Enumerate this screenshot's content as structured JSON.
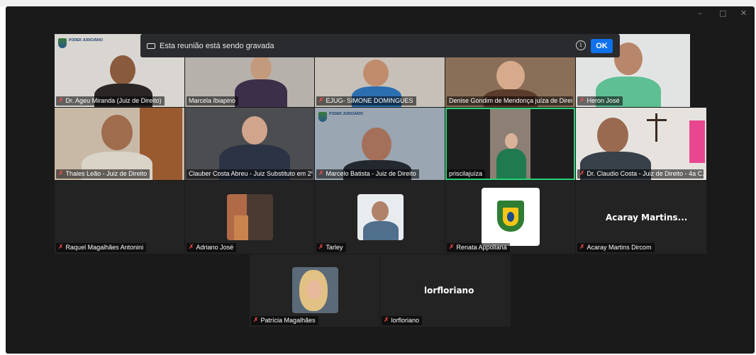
{
  "window": {
    "minimize_glyph": "–",
    "maximize_glyph": "□",
    "close_glyph": "✕"
  },
  "recording_banner": {
    "text": "Esta reunião está sendo gravada",
    "ok_label": "OK",
    "info_glyph": "i"
  },
  "logo": {
    "org": "PODER JUDICIÁRIO",
    "sub": "Tribunal de Justiça do Estado de Goiás"
  },
  "participants": [
    {
      "name": "Dr. Ageu Miranda (Juiz de Direito)",
      "muted": true
    },
    {
      "name": "Marcela Ibiapino",
      "muted": false
    },
    {
      "name": "EJUG- SIMONE DOMINGUES",
      "muted": true
    },
    {
      "name": "Denise Gondim de Mendonça juíza de Direi...",
      "muted": false
    },
    {
      "name": "Heron José",
      "muted": true
    },
    {
      "name": "Thales Leão - Juiz de Direito",
      "muted": true
    },
    {
      "name": "Clauber Costa Abreu - Juiz Substituto em 2º...",
      "muted": false
    },
    {
      "name": "Marcelo Batista - Juiz de Direito",
      "muted": true
    },
    {
      "name": "priscilajuíza",
      "muted": false
    },
    {
      "name": "Dr. Claudio Costa - Juiz de Direito - 4a C...",
      "muted": true
    },
    {
      "name": "Raquel Magalhães Antonini",
      "muted": true
    },
    {
      "name": "Adriano José",
      "muted": true
    },
    {
      "name": "Tarley",
      "muted": true
    },
    {
      "name": "Renata Appoliana",
      "muted": true
    },
    {
      "name": "Acaray Martins Dircom",
      "muted": true
    },
    {
      "name": "Patrícia Magalhães",
      "muted": true
    },
    {
      "name": "lorfloriano",
      "muted": true
    }
  ],
  "placeholders": {
    "acaray": "Acaray Martins...",
    "lorfloriano": "lorfloriano"
  },
  "icons": {
    "mic_muted": "mic-muted-icon",
    "recording": "recording-icon"
  },
  "colors": {
    "active_speaker": "#2bd27a",
    "ok_button": "#0e72ed",
    "muted_mic": "#ff4b4b"
  }
}
